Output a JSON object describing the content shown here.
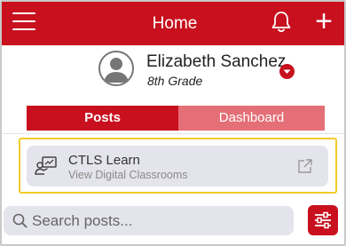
{
  "header": {
    "title": "Home",
    "menu_icon": "hamburger-menu-icon",
    "notification_icon": "bell-icon",
    "add_icon": "plus-icon",
    "add_label": "+",
    "background_color": "#c8101e"
  },
  "profile": {
    "name": "Elizabeth Sanchez",
    "grade": "8th Grade",
    "avatar_icon": "user-avatar-icon",
    "dropdown_icon": "chevron-down-icon"
  },
  "tabs": [
    {
      "label": "Posts",
      "active": true
    },
    {
      "label": "Dashboard",
      "active": false
    }
  ],
  "link_card": {
    "title": "CTLS Learn",
    "subtitle": "View Digital Classrooms",
    "icon": "classroom-presenter-icon",
    "external_icon": "external-link-icon",
    "highlight_color": "#f2cb2c"
  },
  "search": {
    "placeholder": "Search posts...",
    "value": "",
    "icon": "search-icon",
    "filter_icon": "sliders-filter-icon"
  },
  "colors": {
    "accent": "#c8101e",
    "tab_inactive": "#e46f76",
    "card_background": "#e4e4ec"
  }
}
